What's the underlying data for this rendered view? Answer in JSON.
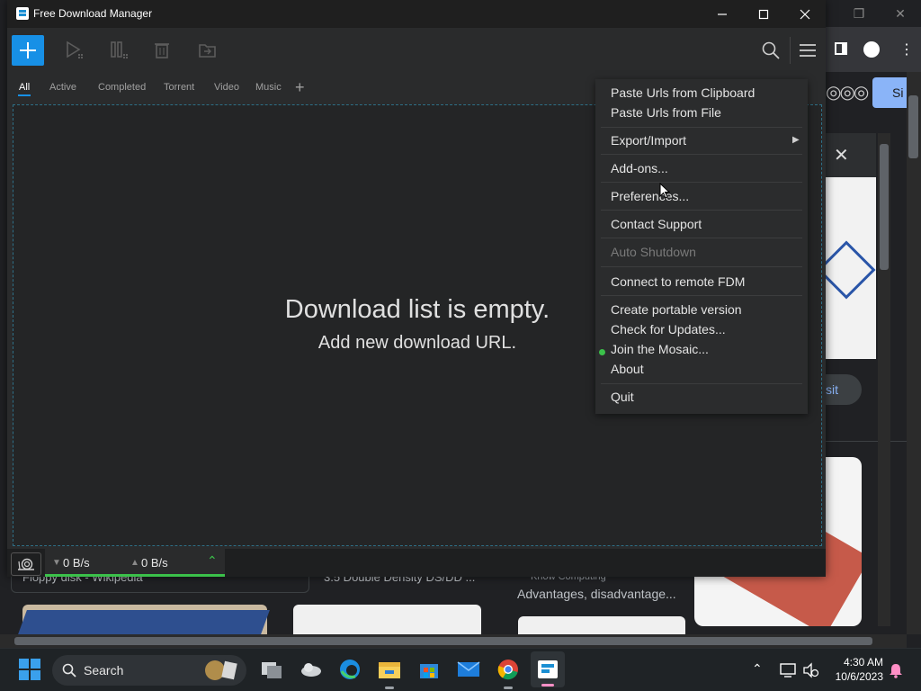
{
  "browser": {
    "tab_label": "Si",
    "card1_text": "Floppy disk - Wikipedia",
    "card2_text": "3.5 Double Density DS/DD ...",
    "card3_source": "Know Computing",
    "card3_text": "Advantages, disadvantage...",
    "visit_label": "sit"
  },
  "window": {
    "title": "Free Download Manager"
  },
  "filters": [
    "All",
    "Active",
    "Completed",
    "Torrent",
    "Video",
    "Music"
  ],
  "empty_state": {
    "heading": "Download list is empty.",
    "subheading": "Add new download URL."
  },
  "status": {
    "down_speed": "0 B/s",
    "up_speed": "0 B/s"
  },
  "menu": {
    "paste_clipboard": "Paste Urls from Clipboard",
    "paste_file": "Paste Urls from File",
    "export_import": "Export/Import",
    "addons": "Add-ons...",
    "preferences": "Preferences...",
    "contact": "Contact Support",
    "auto_shutdown": "Auto Shutdown",
    "remote": "Connect to remote FDM",
    "portable": "Create portable version",
    "updates": "Check for Updates...",
    "mosaic": "Join the Mosaic...",
    "about": "About",
    "quit": "Quit"
  },
  "taskbar": {
    "search_label": "Search",
    "time": "4:30 AM",
    "date": "10/6/2023"
  },
  "colors": {
    "accent": "#1790e6",
    "active_green": "#3bc14a",
    "list_border": "#2e6f86"
  }
}
